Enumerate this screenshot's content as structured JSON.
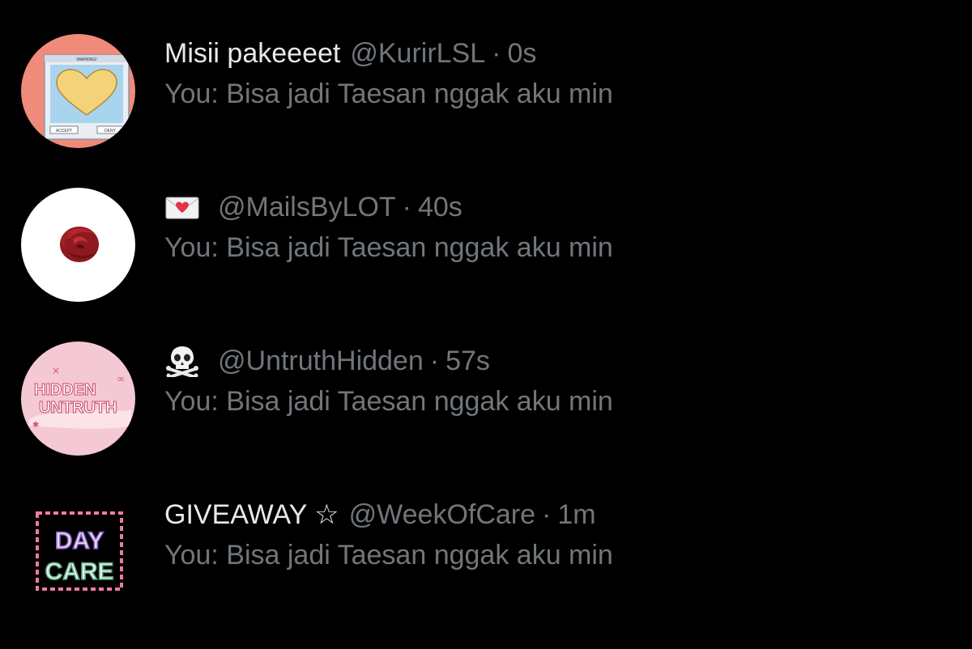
{
  "conversations": [
    {
      "display_name": "Misii pakeeeet",
      "handle": "@KurirLSL",
      "separator": "·",
      "time": "0s",
      "preview": "You: Bisa jadi Taesan nggak aku min",
      "avatar_icon": "warning-dialog-heart-icon",
      "avatar_texts": [
        "WARNING!",
        "ACCEPT",
        "DENY"
      ]
    },
    {
      "display_name_icon": "love-letter-icon",
      "handle": "@MailsByLOT",
      "separator": "·",
      "time": "40s",
      "preview": "You: Bisa jadi Taesan nggak aku min",
      "avatar_icon": "red-rose-icon"
    },
    {
      "display_name_icon": "skull-and-crossbones-icon",
      "handle": "@UntruthHidden",
      "separator": "·",
      "time": "57s",
      "preview": "You: Bisa jadi Taesan nggak aku min",
      "avatar_icon": "hidden-untruth-logo",
      "avatar_texts": [
        "HIDDEN",
        "UNTRUTH"
      ]
    },
    {
      "display_name": "GIVEAWAY ☆",
      "handle": "@WeekOfCare",
      "separator": "·",
      "time": "1m",
      "preview": "You: Bisa jadi Taesan nggak aku min",
      "avatar_icon": "day-care-logo",
      "avatar_texts": [
        "DAY",
        "CARE"
      ]
    }
  ],
  "colors": {
    "background": "#000000",
    "primary_text": "#e7e9ea",
    "secondary_text": "#71767b",
    "avatar1_bg": "#f08a7a",
    "avatar3_bg": "#f4c9d4"
  }
}
